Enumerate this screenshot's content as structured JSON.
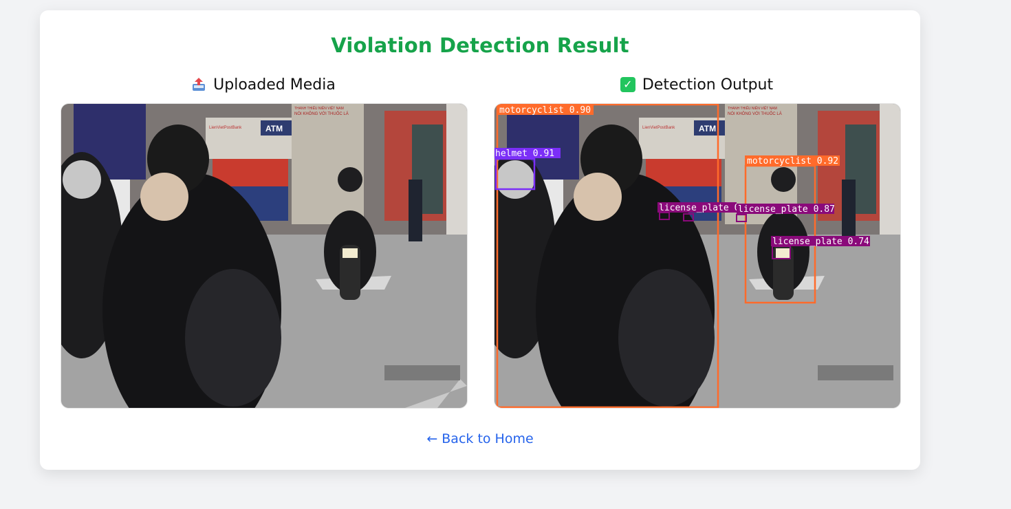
{
  "page": {
    "title": "Violation Detection Result",
    "back_link": "← Back to Home"
  },
  "panels": {
    "uploaded": {
      "label": "Uploaded Media",
      "icon": "inbox-tray-upload-icon"
    },
    "output": {
      "label": "Detection Output",
      "icon": "check-mark-button-icon"
    }
  },
  "scene": {
    "atm_sign": "ATM",
    "bank_sign": "LienVietPostBank",
    "poster_line1": "THANH THIẾU NIÊN VIỆT NAM",
    "poster_line2": "NÓI KHÔNG VỚI THUỐC LÁ"
  },
  "detections": [
    {
      "label": "motorcyclist 0.90",
      "class": "motorcyclist",
      "color": "#ff6b2b"
    },
    {
      "label": "helmet 0.91",
      "class": "helmet",
      "color": "#7b2ff7"
    },
    {
      "label": "motorcyclist 0.92",
      "class": "motorcyclist",
      "color": "#ff6b2b"
    },
    {
      "label": "license_plate 0.",
      "class": "license_plate",
      "color": "#8a0a7a"
    },
    {
      "label": "license_plate 0.87",
      "class": "license_plate",
      "color": "#8a0a7a"
    },
    {
      "label": "license_plate 0.74",
      "class": "license_plate",
      "color": "#8a0a7a"
    }
  ],
  "colors": {
    "title": "#16a34a",
    "link": "#2563eb",
    "background": "#f2f3f5"
  }
}
